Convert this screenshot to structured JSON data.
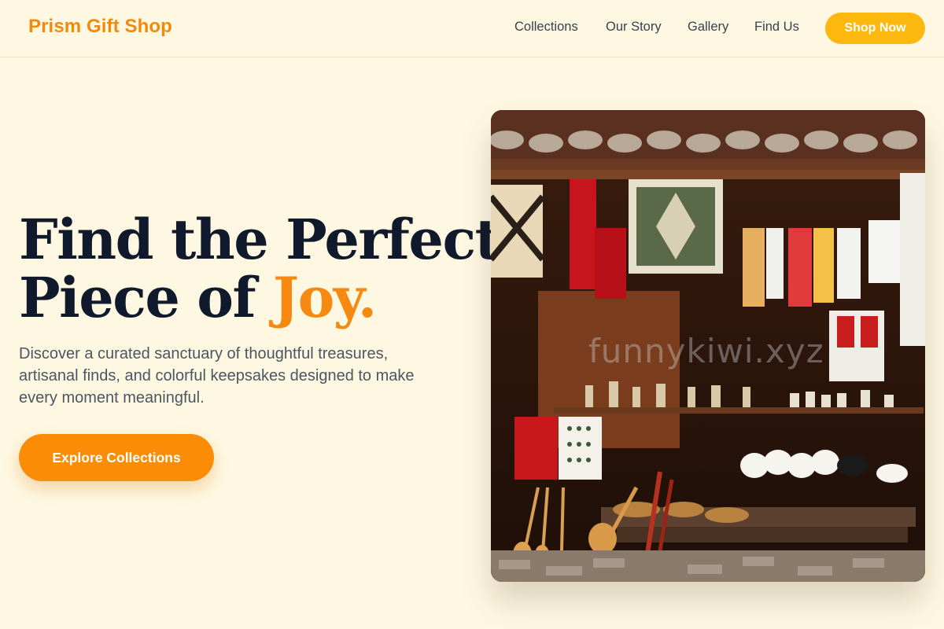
{
  "header": {
    "brand": "Prism Gift Shop",
    "nav": [
      {
        "label": "Collections"
      },
      {
        "label": "Our Story"
      },
      {
        "label": "Gallery"
      },
      {
        "label": "Find Us"
      }
    ],
    "cta": "Shop Now"
  },
  "hero": {
    "title_line1": "Find the Perfect",
    "title_line2_pre": "Piece of ",
    "title_accent": "Joy.",
    "subtitle": "Discover a curated sanctuary of thoughtful treasures, artisanal finds, and colorful keepsakes designed to make every moment meaningful.",
    "button": "Explore Collections"
  },
  "image": {
    "watermark": "funnykiwi.xyz"
  },
  "colors": {
    "background": "#fef8e2",
    "brand": "#f08a0f",
    "cta": "#fcb80f",
    "accent": "#f6890f",
    "heading": "#111a2c"
  }
}
